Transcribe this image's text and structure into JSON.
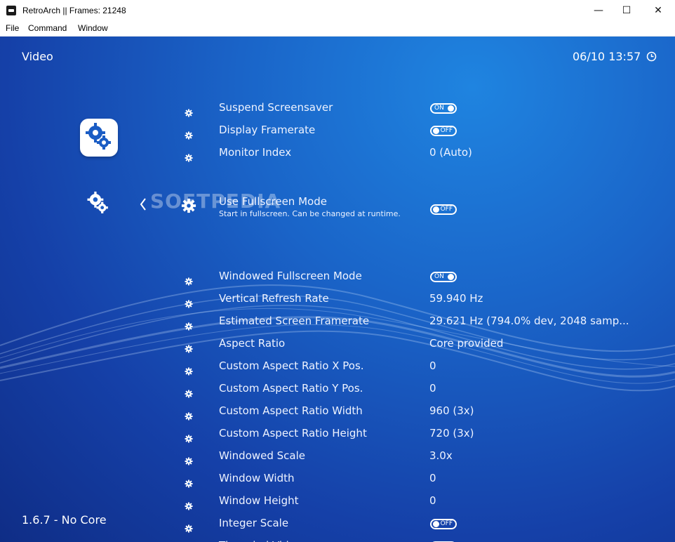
{
  "window": {
    "title": "RetroArch   || Frames: 21248",
    "controls": {
      "minimize": "—",
      "maximize": "☐",
      "close": "✕"
    }
  },
  "menubar": [
    "File",
    "Command",
    "Window"
  ],
  "header": {
    "section": "Video",
    "clock": "06/10 13:57",
    "clock_icon": "clock-icon"
  },
  "footer": {
    "version": "1.6.7 - No Core"
  },
  "watermark": "SOFTPEDIA",
  "colors": {
    "background": "#1a5cc4",
    "text": "#eef3ff"
  },
  "settings": [
    {
      "label": "Suspend Screensaver",
      "value": "ON",
      "kind": "toggle"
    },
    {
      "label": "Display Framerate",
      "value": "OFF",
      "kind": "toggle"
    },
    {
      "label": "Monitor Index",
      "value": "0 (Auto)",
      "kind": "text"
    },
    {
      "label": "Use Fullscreen Mode",
      "value": "OFF",
      "kind": "toggle",
      "sublabel": "Start in fullscreen. Can be changed at runtime.",
      "selected": true
    },
    {
      "label": "Windowed Fullscreen Mode",
      "value": "ON",
      "kind": "toggle"
    },
    {
      "label": "Vertical Refresh Rate",
      "value": "59.940 Hz",
      "kind": "text"
    },
    {
      "label": "Estimated Screen Framerate",
      "value": "29.621 Hz (794.0% dev, 2048 samp...",
      "kind": "text"
    },
    {
      "label": "Aspect Ratio",
      "value": "Core provided",
      "kind": "text"
    },
    {
      "label": "Custom Aspect Ratio X Pos.",
      "value": "0",
      "kind": "text"
    },
    {
      "label": "Custom Aspect Ratio Y Pos.",
      "value": "0",
      "kind": "text"
    },
    {
      "label": "Custom Aspect Ratio Width",
      "value": "960 (3x)",
      "kind": "text"
    },
    {
      "label": "Custom Aspect Ratio Height",
      "value": "720 (3x)",
      "kind": "text"
    },
    {
      "label": "Windowed Scale",
      "value": "3.0x",
      "kind": "text"
    },
    {
      "label": "Window Width",
      "value": "0",
      "kind": "text"
    },
    {
      "label": "Window Height",
      "value": "0",
      "kind": "text"
    },
    {
      "label": "Integer Scale",
      "value": "OFF",
      "kind": "toggle"
    },
    {
      "label": "Threaded Video",
      "value": "OFF",
      "kind": "toggle"
    }
  ]
}
